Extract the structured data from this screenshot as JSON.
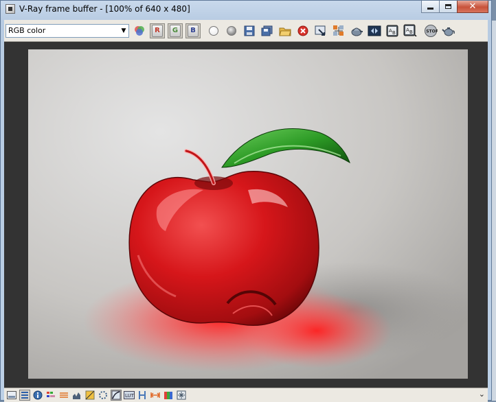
{
  "window": {
    "title": "V-Ray frame buffer - [100% of 640 x 480]",
    "minimize_icon": "minimize-icon",
    "maximize_icon": "maximize-icon",
    "close_label": "✕"
  },
  "toolbar": {
    "channel_select": {
      "value": "RGB color",
      "arrow": "▼"
    },
    "channel_buttons": [
      {
        "label": "R",
        "icon": "red-channel-icon",
        "pressed": true
      },
      {
        "label": "G",
        "icon": "green-channel-icon",
        "pressed": true
      },
      {
        "label": "B",
        "icon": "blue-channel-icon",
        "pressed": true
      }
    ],
    "icons": [
      "switch-channel-icon",
      "white-ball-icon",
      "mono-ball-icon",
      "save-image-icon",
      "save-all-icon",
      "load-image-icon",
      "clear-image-icon",
      "duplicate-to-max-icon",
      "track-mouse-icon",
      "region-render-icon",
      "render-last-icon",
      "stamp-a-icon",
      "stamp-b-icon",
      "stop-render-icon",
      "teapot-icon"
    ]
  },
  "statusbar": {
    "buttons": [
      {
        "icon": "display-colors-icon",
        "pressed": false
      },
      {
        "icon": "color-correction-icon",
        "pressed": true
      },
      {
        "icon": "info-icon",
        "pressed": false
      },
      {
        "icon": "levels-icon",
        "pressed": false
      },
      {
        "icon": "curves-icon",
        "pressed": false
      },
      {
        "icon": "histogram-icon",
        "pressed": false
      },
      {
        "icon": "exposure-icon",
        "pressed": false
      },
      {
        "icon": "white-balance-icon",
        "pressed": false
      },
      {
        "icon": "srgb-icon",
        "pressed": true
      },
      {
        "icon": "lut-icon",
        "pressed": false
      },
      {
        "icon": "hue-icon",
        "pressed": false
      },
      {
        "icon": "ocio-icon",
        "pressed": false
      },
      {
        "icon": "compare-icon",
        "pressed": false
      },
      {
        "icon": "pixel-aspect-icon",
        "pressed": false
      }
    ],
    "expand_label": "⌄"
  },
  "colors": {
    "apple": "#d21417",
    "leaf": "#2f9e2a",
    "viewport_bg": "#333333"
  }
}
